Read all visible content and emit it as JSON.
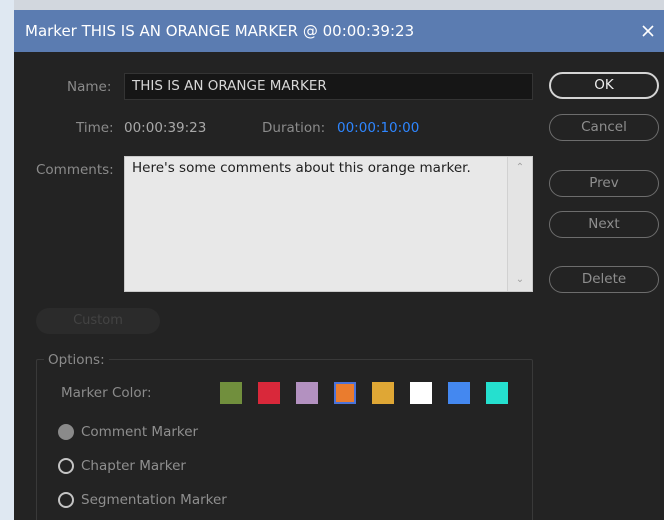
{
  "dialog": {
    "title": "Marker THIS IS AN ORANGE MARKER @ 00:00:39:23",
    "close_icon": "close-icon"
  },
  "form": {
    "name_label": "Name:",
    "name_value": "THIS IS AN ORANGE MARKER",
    "time_label": "Time:",
    "time_value": "00:00:39:23",
    "duration_label": "Duration:",
    "duration_value": "00:00:10:00",
    "comments_label": "Comments:",
    "comments_value": "Here's some comments about this orange marker."
  },
  "buttons": {
    "ok": "OK",
    "cancel": "Cancel",
    "prev": "Prev",
    "next": "Next",
    "delete": "Delete",
    "custom": "Custom"
  },
  "options": {
    "label": "Options:",
    "marker_color_label": "Marker Color:",
    "colors": [
      {
        "name": "green",
        "hex": "#718f3d",
        "selected": false
      },
      {
        "name": "red",
        "hex": "#d9283a",
        "selected": false
      },
      {
        "name": "mauve",
        "hex": "#b391c0",
        "selected": false
      },
      {
        "name": "orange",
        "hex": "#ea7c2e",
        "selected": true
      },
      {
        "name": "yellow",
        "hex": "#dfa735",
        "selected": false
      },
      {
        "name": "white",
        "hex": "#ffffff",
        "selected": false
      },
      {
        "name": "blue",
        "hex": "#4488f0",
        "selected": false
      },
      {
        "name": "cyan",
        "hex": "#25e0cf",
        "selected": false
      }
    ],
    "marker_types": [
      {
        "label": "Comment Marker",
        "checked": true
      },
      {
        "label": "Chapter Marker",
        "checked": false
      },
      {
        "label": "Segmentation Marker",
        "checked": false
      }
    ]
  },
  "theme": {
    "titlebar": "#5b7cb1",
    "dialog_background": "#232323",
    "duration_accent": "#2e86ff"
  }
}
